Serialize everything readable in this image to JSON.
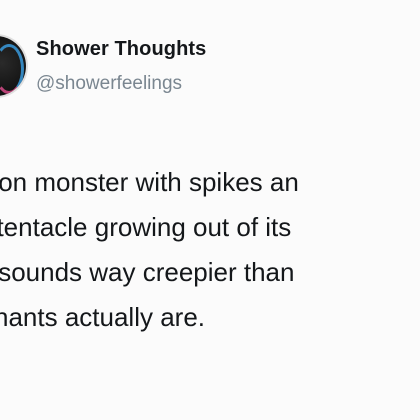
{
  "tweet": {
    "display_name": "Shower Thoughts",
    "handle": "@showerfeelings",
    "lines": [
      "ton monster with spikes an",
      "t tentacle growing out of its",
      "' sounds way creepier than",
      "hants actually are."
    ]
  },
  "colors": {
    "text": "#14171a",
    "handle": "#7a8690",
    "background": "#fbfbfb"
  }
}
